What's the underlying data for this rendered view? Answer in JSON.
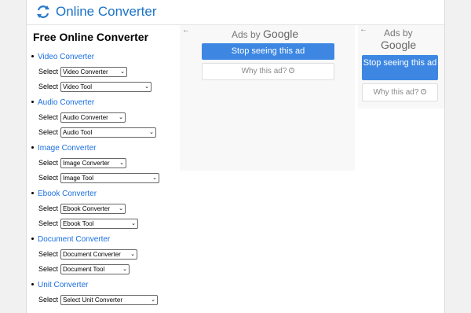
{
  "header": {
    "site_name": "Online Converter"
  },
  "sidebar": {
    "title": "Free Online Converter",
    "select_label": "Select",
    "categories": [
      {
        "label": "Video Converter",
        "converter_select": "Video Converter",
        "tool_select": "Video Tool"
      },
      {
        "label": "Audio Converter",
        "converter_select": "Audio Converter",
        "tool_select": "Audio Tool"
      },
      {
        "label": "Image Converter",
        "converter_select": "Image Converter",
        "tool_select": "Image Tool"
      },
      {
        "label": "Ebook Converter",
        "converter_select": "Ebook Converter",
        "tool_select": "Ebook Tool"
      },
      {
        "label": "Document Converter",
        "converter_select": "Document Converter",
        "tool_select": "Document Tool"
      },
      {
        "label": "Unit Converter",
        "converter_select": "Select Unit Converter"
      }
    ]
  },
  "ads": {
    "ads_by": "Ads by",
    "google": "Google",
    "stop_label": "Stop seeing this ad",
    "why_label": "Why this ad?",
    "info_glyph": "i",
    "back_glyph": "←"
  }
}
